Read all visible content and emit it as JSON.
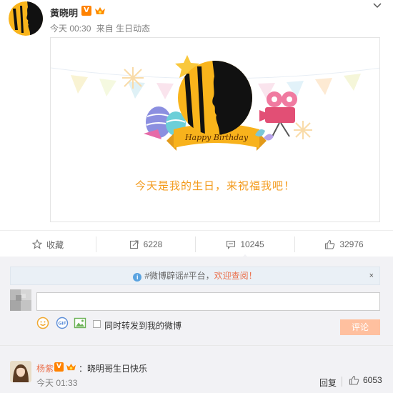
{
  "post": {
    "author": "黄晓明",
    "verified_badge": "V",
    "time": "今天 00:30",
    "source_prefix": "来自",
    "source": "生日动态",
    "card_badge_text": "Happy Birthday",
    "card_text": "今天是我的生日，来祝福我吧！"
  },
  "actions": {
    "favorite_label": "收藏",
    "repost_count": "6228",
    "comment_count": "10245",
    "like_count": "32976"
  },
  "comment_box": {
    "notice_prefix": "#微博辟谣#平台，",
    "notice_link": "欢迎查阅！",
    "notice_close": "×",
    "input_value": "",
    "repost_checkbox_label": "同时转发到我的微博",
    "submit_label": "评论"
  },
  "comments": [
    {
      "name": "杨紫",
      "badge": "V",
      "text": "：晓明哥生日快乐",
      "time": "今天 01:33",
      "reply_label": "回复",
      "like_count": "6053"
    }
  ],
  "colors": {
    "accent_orange": "#ff8200",
    "card_text": "#f39a1b",
    "link_orange": "#eb7350",
    "submit_disabled": "#ffc09f",
    "yellow": "#f9b41b"
  },
  "icons": [
    "chevron-down-icon",
    "star-icon",
    "repost-icon",
    "comment-icon",
    "thumbs-up-icon",
    "info-icon",
    "close-icon",
    "emoji-icon",
    "gif-icon",
    "image-icon",
    "crown-icon"
  ]
}
